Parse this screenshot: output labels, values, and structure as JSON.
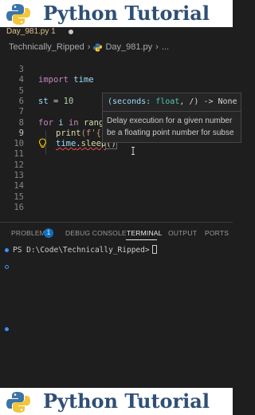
{
  "banner": {
    "title": "Python Tutorial",
    "logo_icon": "python-logo"
  },
  "editor": {
    "tab": {
      "filename": "Day_981.py 1",
      "modified": true
    },
    "breadcrumb": {
      "folder": "Technically_Ripped",
      "file": "Day_981.py",
      "more": "..."
    },
    "line_numbers": [
      "3",
      "4",
      "5",
      "6",
      "7",
      "8",
      "9",
      "10",
      "11",
      "12",
      "13",
      "14",
      "15",
      "16"
    ],
    "active_line": "9",
    "code": {
      "line3": {
        "kw": "import",
        "module": "time"
      },
      "line5": {
        "var": "st",
        "op": " = ",
        "num": "10"
      },
      "line7": {
        "kw_for": "for",
        "var_i": "i",
        "kw_in": "in",
        "fn_range": "range("
      },
      "line8": {
        "fn_print": "print",
        "rest": "(f'{i}"
      },
      "line9": {
        "obj": "time",
        "dot": ".",
        "method": "sleep",
        "paren": "()"
      }
    },
    "hover": {
      "signature_open": "(seconds: ",
      "signature_type": "float",
      "signature_rest": ", /) -> None",
      "doc_line1": "Delay execution for a given number",
      "doc_line2": "be a floating point number for subse"
    }
  },
  "panel": {
    "tabs": [
      {
        "label": "PROBLEMS",
        "badge": "1"
      },
      {
        "label": "DEBUG CONSOLE"
      },
      {
        "label": "TERMINAL",
        "active": true
      },
      {
        "label": "OUTPUT"
      },
      {
        "label": "PORTS"
      }
    ],
    "terminal_prompt": "PS D:\\Code\\Technically_Ripped>"
  },
  "colors": {
    "banner_text": "#2f4f74",
    "python_blue": "#3b74a8",
    "python_yellow": "#f3c53a",
    "editor_bg": "#1e1e1e",
    "keyword": "#c586c0",
    "variable": "#9cdcfe",
    "function": "#dcdcaa",
    "number": "#b5cea8",
    "accent": "#0e70c0"
  }
}
